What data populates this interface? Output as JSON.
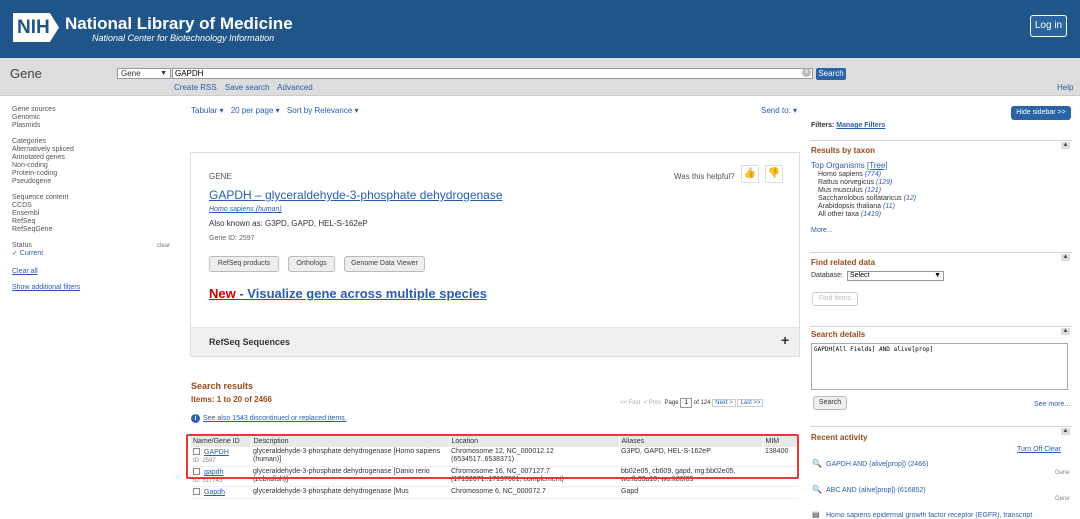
{
  "header": {
    "logo": "NIH",
    "title": "National Library of Medicine",
    "subtitle": "National Center for Biotechnology Information",
    "login": "Log in"
  },
  "search": {
    "db_title": "Gene",
    "db_selected": "Gene",
    "query": "GAPDH",
    "button": "Search",
    "links": [
      "Create RSS",
      "Save search",
      "Advanced"
    ],
    "help": "Help"
  },
  "sidebar": {
    "gene_sources": {
      "title": "Gene sources",
      "items": [
        "Genomic",
        "Plasmids"
      ]
    },
    "categories": {
      "title": "Categories",
      "items": [
        "Alternatively spliced",
        "Annotated genes",
        "Non-coding",
        "Protein-coding",
        "Pseudogene"
      ]
    },
    "sequence_content": {
      "title": "Sequence content",
      "items": [
        "CCDS",
        "Ensembl",
        "RefSeq",
        "RefSeqGene"
      ]
    },
    "status": {
      "title": "Status",
      "clear": "clear",
      "current": "✓ Current"
    },
    "clear_all": "Clear all",
    "additional": "Show additional filters"
  },
  "controls": {
    "format": "Tabular ▾",
    "per_page": "20 per page ▾",
    "sort": "Sort by Relevance ▾",
    "send_to": "Send to: ▾"
  },
  "gene_card": {
    "type": "GENE",
    "helpful": "Was this helpful?",
    "title": "GAPDH – glyceraldehyde-3-phosphate dehydrogenase",
    "organism": "Homo sapiens (human)",
    "also_known": "Also known as: G3PD, GAPD, HEL-S-162eP",
    "gene_id": "Gene ID: 2597",
    "buttons": [
      "RefSeq products",
      "Orthologs",
      "Genome Data Viewer"
    ],
    "new_label": "New",
    "new_text": " - Visualize gene across multiple species",
    "refseq_label": "RefSeq Sequences",
    "refseq_toggle": "+"
  },
  "results": {
    "title": "Search results",
    "items": "Items: 1 to 20 of 2466",
    "pager": {
      "first": "<< First",
      "prev": "< Prev",
      "page_label": "Page",
      "page": "1",
      "of": "of 124",
      "next": "Next >",
      "last": "Last >>"
    },
    "see_also": "See also 1543 discontinued or replaced items.",
    "columns": [
      "Name/Gene ID",
      "Description",
      "Location",
      "Aliases",
      "MIM"
    ],
    "rows": [
      {
        "name": "GAPDH",
        "id": "ID: 2597",
        "desc": "glyceraldehyde-3-phosphate dehydrogenase [Homo sapiens (human)]",
        "loc": "Chromosome 12, NC_000012.12 (6534517..6538371)",
        "aliases": "G3PD, GAPD, HEL-S-162eP",
        "mim": "138400"
      },
      {
        "name": "gapdh",
        "id": "ID: 317743",
        "desc": "glyceraldehyde-3-phosphate dehydrogenase [Danio rerio (zebrafish)]",
        "loc": "Chromosome 16, NC_007127.7 (17192671..17197601, complement)",
        "aliases": "bb02e05, cb609, gapd, mg:bb02e05, wu:fb33a10, wu:ft80f05",
        "mim": ""
      },
      {
        "name": "Gapdh",
        "id": "",
        "desc": "glyceraldehyde-3-phosphate dehydrogenase [Mus",
        "loc": "Chromosome 6, NC_000072.7",
        "aliases": "Gapd",
        "mim": ""
      }
    ]
  },
  "right": {
    "hide_sidebar": "Hide sidebar >>",
    "filters_label": "Filters:",
    "manage_filters": "Manage Filters",
    "taxon_title": "Results by taxon",
    "top_organisms": "Top Organisms",
    "tree": "[Tree]",
    "taxa": [
      {
        "name": "Homo sapiens",
        "count": "(774)"
      },
      {
        "name": "Rattus norvegicus",
        "count": "(129)"
      },
      {
        "name": "Mus musculus",
        "count": "(121)"
      },
      {
        "name": "Saccharolobus solfataricus",
        "count": "(12)"
      },
      {
        "name": "Arabidopsis thaliana",
        "count": "(11)"
      },
      {
        "name": "All other taxa",
        "count": "(1419)"
      }
    ],
    "more": "More...",
    "related_title": "Find related data",
    "database_label": "Database:",
    "database_value": "Select",
    "find_items": "Find items",
    "details_title": "Search details",
    "details_query": "GAPDH[All Fields] AND alive[prop]",
    "search_btn": "Search",
    "see_more": "See more...",
    "activity_title": "Recent activity",
    "turn_off": "Turn Off",
    "clear": "Clear",
    "activity": [
      {
        "text": "GAPDH AND (alive[prop]) (2466)",
        "kind": "Gene"
      },
      {
        "text": "ABC AND (alive[prop]) (616852)",
        "kind": "Gene"
      },
      {
        "text": "Homo sapiens epidermal growth factor receptor (EGFR), transcript",
        "kind": ""
      }
    ]
  }
}
